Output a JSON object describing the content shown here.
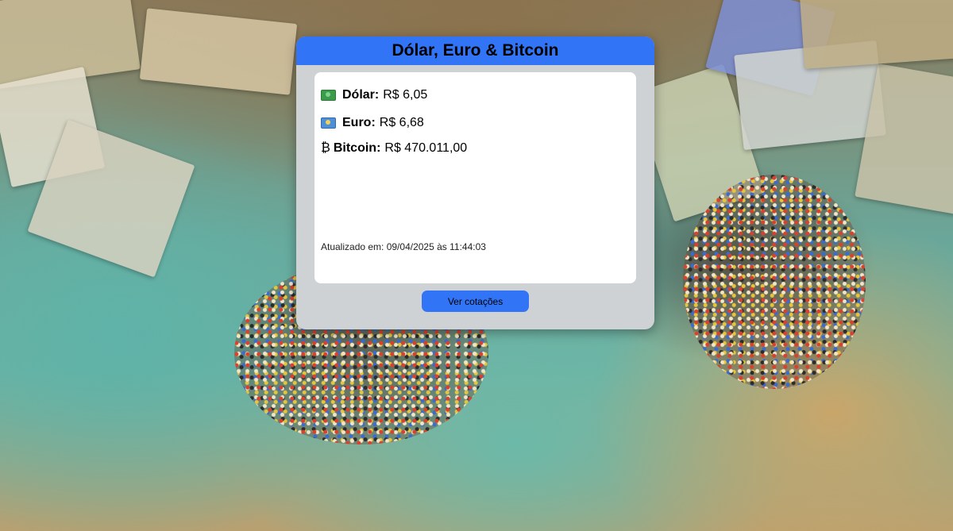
{
  "card": {
    "title": "Dólar, Euro & Bitcoin",
    "rates": [
      {
        "icon": "dollar-banknote-icon",
        "label": "Dólar:",
        "value": "R$ 6,05"
      },
      {
        "icon": "euro-banknote-icon",
        "label": "Euro:",
        "value": "R$ 6,68"
      },
      {
        "icon": "bitcoin-icon",
        "icon_glyph": "₿",
        "label": "Bitcoin:",
        "value": "R$ 470.011,00"
      }
    ],
    "updated_text": "Atualizado em: 09/04/2025 às 11:44:03",
    "button_label": "Ver cotações"
  },
  "colors": {
    "header_blue": "#3274f6",
    "card_gray": "#cfd2d5",
    "panel_white": "#ffffff"
  }
}
